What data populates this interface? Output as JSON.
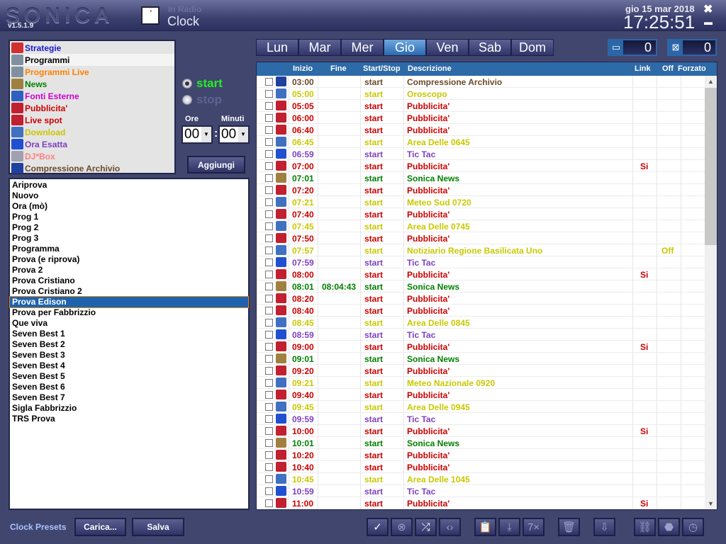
{
  "app": {
    "logo": "SONICA",
    "version": "v1.5.1.9",
    "subtitle": "In Radio",
    "title": "Clock",
    "date": "gio 15 mar 2018",
    "time": "17:25:51",
    "close": "✖",
    "minimize": "▬"
  },
  "categories": [
    {
      "label": "Strategie",
      "color": "#1a1acc",
      "icon": "strategie-icon"
    },
    {
      "label": "Programmi",
      "color": "#000000",
      "icon": "programmi-icon",
      "selected": true
    },
    {
      "label": "Programmi Live",
      "color": "#ff8000",
      "icon": "programmi-live-icon"
    },
    {
      "label": "News",
      "color": "#008000",
      "icon": "news-icon"
    },
    {
      "label": "Fonti Esterne",
      "color": "#cc00cc",
      "icon": "fonti-esterne-icon"
    },
    {
      "label": "Pubblicita'",
      "color": "#cc0000",
      "icon": "pubblicita-icon"
    },
    {
      "label": "Live spot",
      "color": "#cc0000",
      "icon": "live-spot-icon"
    },
    {
      "label": "Download",
      "color": "#c8c800",
      "icon": "download-icon"
    },
    {
      "label": "Ora Esatta",
      "color": "#8040c0",
      "icon": "ora-esatta-icon"
    },
    {
      "label": "DJ*Box",
      "color": "#ff8080",
      "icon": "djbox-icon"
    },
    {
      "label": "Compressione Archivio",
      "color": "#6b4a2a",
      "icon": "compressione-icon"
    }
  ],
  "mode": {
    "start": "start",
    "stop": "stop",
    "selected": "start"
  },
  "time_picker": {
    "hours_label": "Ore",
    "minutes_label": "Minuti",
    "hours": "00",
    "minutes": "00",
    "separator": ":"
  },
  "add_button": "Aggiungi",
  "programs": [
    "Ariprova",
    "Nuovo",
    "Ora (mò)",
    "Prog 1",
    "Prog 2",
    "Prog 3",
    "Programma",
    "Prova (e riprova)",
    "Prova 2",
    "Prova Cristiano",
    "Prova Cristiano 2",
    "Prova Edison",
    "Prova per Fabbrizzio",
    "Que viva",
    "Seven Best 1",
    "Seven Best 2",
    "Seven Best 3",
    "Seven Best 4",
    "Seven Best 5",
    "Seven Best 6",
    "Seven Best 7",
    "Sigla Fabbrizzio",
    "TRS Prova"
  ],
  "selected_program": "Prova Edison",
  "presets": {
    "label": "Clock Presets",
    "load": "Carica...",
    "save": "Salva"
  },
  "days": [
    "Lun",
    "Mar",
    "Mer",
    "Gio",
    "Ven",
    "Sab",
    "Dom"
  ],
  "active_day": "Gio",
  "counters": [
    {
      "icon": "minimize-box-icon",
      "glyph": "▭",
      "value": "0"
    },
    {
      "icon": "checked-box-icon",
      "glyph": "⊠",
      "value": "0"
    }
  ],
  "columns": {
    "start": "Inizio",
    "end": "Fine",
    "action": "Start/Stop",
    "desc": "Descrizione",
    "link": "Link",
    "off": "Off",
    "forced": "Forzato"
  },
  "type_colors": {
    "archive": "#6b4a2a",
    "download": "#c8c800",
    "spot": "#cc0000",
    "time": "#8040c0",
    "news": "#008000"
  },
  "rows": [
    {
      "start": "03:00",
      "end": "",
      "action": "start",
      "desc": "Compressione Archivio",
      "link": "",
      "off": "",
      "type": "archive"
    },
    {
      "start": "05:00",
      "end": "",
      "action": "start",
      "desc": "Oroscopo",
      "link": "",
      "off": "",
      "type": "download"
    },
    {
      "start": "05:05",
      "end": "",
      "action": "start",
      "desc": "Pubblicita'",
      "link": "",
      "off": "",
      "type": "spot"
    },
    {
      "start": "06:00",
      "end": "",
      "action": "start",
      "desc": "Pubblicita'",
      "link": "",
      "off": "",
      "type": "spot"
    },
    {
      "start": "06:40",
      "end": "",
      "action": "start",
      "desc": "Pubblicita'",
      "link": "",
      "off": "",
      "type": "spot"
    },
    {
      "start": "06:45",
      "end": "",
      "action": "start",
      "desc": "Area Delle 0645",
      "link": "",
      "off": "",
      "type": "download"
    },
    {
      "start": "06:59",
      "end": "",
      "action": "start",
      "desc": "Tic Tac",
      "link": "",
      "off": "",
      "type": "time"
    },
    {
      "start": "07:00",
      "end": "",
      "action": "start",
      "desc": "Pubblicita'",
      "link": "Si",
      "off": "",
      "type": "spot"
    },
    {
      "start": "07:01",
      "end": "",
      "action": "start",
      "desc": "Sonica News",
      "link": "",
      "off": "",
      "type": "news"
    },
    {
      "start": "07:20",
      "end": "",
      "action": "start",
      "desc": "Pubblicita'",
      "link": "",
      "off": "",
      "type": "spot"
    },
    {
      "start": "07:21",
      "end": "",
      "action": "start",
      "desc": "Meteo Sud 0720",
      "link": "",
      "off": "",
      "type": "download"
    },
    {
      "start": "07:40",
      "end": "",
      "action": "start",
      "desc": "Pubblicita'",
      "link": "",
      "off": "",
      "type": "spot"
    },
    {
      "start": "07:45",
      "end": "",
      "action": "start",
      "desc": "Area Delle 0745",
      "link": "",
      "off": "",
      "type": "download"
    },
    {
      "start": "07:50",
      "end": "",
      "action": "start",
      "desc": "Pubblicita'",
      "link": "",
      "off": "",
      "type": "spot"
    },
    {
      "start": "07:57",
      "end": "",
      "action": "start",
      "desc": "Notiziario Regione Basilicata Uno",
      "link": "",
      "off": "Off",
      "type": "download"
    },
    {
      "start": "07:59",
      "end": "",
      "action": "start",
      "desc": "Tic Tac",
      "link": "",
      "off": "",
      "type": "time"
    },
    {
      "start": "08:00",
      "end": "",
      "action": "start",
      "desc": "Pubblicita'",
      "link": "Si",
      "off": "",
      "type": "spot"
    },
    {
      "start": "08:01",
      "end": "08:04:43",
      "action": "start",
      "desc": "Sonica News",
      "link": "",
      "off": "",
      "type": "news"
    },
    {
      "start": "08:20",
      "end": "",
      "action": "start",
      "desc": "Pubblicita'",
      "link": "",
      "off": "",
      "type": "spot"
    },
    {
      "start": "08:40",
      "end": "",
      "action": "start",
      "desc": "Pubblicita'",
      "link": "",
      "off": "",
      "type": "spot"
    },
    {
      "start": "08:45",
      "end": "",
      "action": "start",
      "desc": "Area Delle 0845",
      "link": "",
      "off": "",
      "type": "download"
    },
    {
      "start": "08:59",
      "end": "",
      "action": "start",
      "desc": "Tic Tac",
      "link": "",
      "off": "",
      "type": "time"
    },
    {
      "start": "09:00",
      "end": "",
      "action": "start",
      "desc": "Pubblicita'",
      "link": "Si",
      "off": "",
      "type": "spot"
    },
    {
      "start": "09:01",
      "end": "",
      "action": "start",
      "desc": "Sonica News",
      "link": "",
      "off": "",
      "type": "news"
    },
    {
      "start": "09:20",
      "end": "",
      "action": "start",
      "desc": "Pubblicita'",
      "link": "",
      "off": "",
      "type": "spot"
    },
    {
      "start": "09:21",
      "end": "",
      "action": "start",
      "desc": "Meteo Nazionale 0920",
      "link": "",
      "off": "",
      "type": "download"
    },
    {
      "start": "09:40",
      "end": "",
      "action": "start",
      "desc": "Pubblicita'",
      "link": "",
      "off": "",
      "type": "spot"
    },
    {
      "start": "09:45",
      "end": "",
      "action": "start",
      "desc": "Area Delle 0945",
      "link": "",
      "off": "",
      "type": "download"
    },
    {
      "start": "09:59",
      "end": "",
      "action": "start",
      "desc": "Tic Tac",
      "link": "",
      "off": "",
      "type": "time"
    },
    {
      "start": "10:00",
      "end": "",
      "action": "start",
      "desc": "Pubblicita'",
      "link": "Si",
      "off": "",
      "type": "spot"
    },
    {
      "start": "10:01",
      "end": "",
      "action": "start",
      "desc": "Sonica News",
      "link": "",
      "off": "",
      "type": "news"
    },
    {
      "start": "10:20",
      "end": "",
      "action": "start",
      "desc": "Pubblicita'",
      "link": "",
      "off": "",
      "type": "spot"
    },
    {
      "start": "10:40",
      "end": "",
      "action": "start",
      "desc": "Pubblicita'",
      "link": "",
      "off": "",
      "type": "spot"
    },
    {
      "start": "10:45",
      "end": "",
      "action": "start",
      "desc": "Area Delle 1045",
      "link": "",
      "off": "",
      "type": "download"
    },
    {
      "start": "10:59",
      "end": "",
      "action": "start",
      "desc": "Tic Tac",
      "link": "",
      "off": "",
      "type": "time"
    },
    {
      "start": "11:00",
      "end": "",
      "action": "start",
      "desc": "Pubblicita'",
      "link": "Si",
      "off": "",
      "type": "spot"
    }
  ],
  "toolbar": [
    {
      "name": "check-all-button",
      "glyph": "✓",
      "enabled": true
    },
    {
      "name": "uncheck-all-button",
      "glyph": "⊗",
      "enabled": false
    },
    {
      "name": "shuffle-button",
      "glyph": "⤮",
      "enabled": true
    },
    {
      "name": "expand-button",
      "glyph": "‹›",
      "enabled": false
    },
    {
      "name": "paste-button",
      "glyph": "📋",
      "enabled": false
    },
    {
      "name": "import-button",
      "glyph": "⤓",
      "enabled": false
    },
    {
      "name": "copy-7x-button",
      "glyph": "7×",
      "enabled": false
    },
    {
      "name": "delete-button",
      "glyph": "🗑",
      "enabled": false
    },
    {
      "name": "export-button",
      "glyph": "⇩",
      "enabled": false
    },
    {
      "name": "link-button",
      "glyph": "⛓",
      "enabled": false
    },
    {
      "name": "stop-button",
      "glyph": "⬣",
      "enabled": false
    },
    {
      "name": "alarm-button",
      "glyph": "◷",
      "enabled": false
    }
  ]
}
